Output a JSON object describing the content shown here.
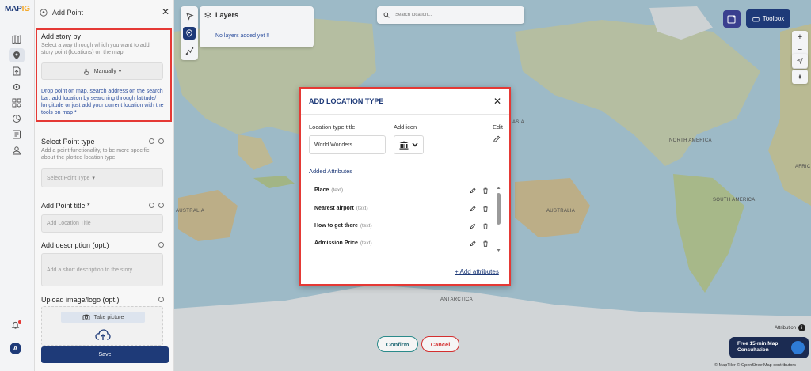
{
  "app": {
    "logo_text_a": "MAP",
    "logo_text_b": "IG"
  },
  "panel": {
    "title": "Add Point",
    "story": {
      "title": "Add story by",
      "hint": "Select a way through which you want to add story point (locations) on the map",
      "mode_label": "Manually",
      "description": "Drop point on map, search address on the search bar, add location by searching through latitude/ longitude or just add your current location with the tools on map *"
    },
    "point_type": {
      "title": "Select Point type",
      "hint": "Add a point functionality, to be more specific about the plotted location type",
      "placeholder": "Select Point Type"
    },
    "point_title": {
      "title": "Add Point title *",
      "placeholder": "Add Location Title"
    },
    "description": {
      "title": "Add description (opt.)",
      "placeholder": "Add a short description to the story"
    },
    "upload": {
      "title": "Upload image/logo (opt.)",
      "take_picture": "Take picture"
    },
    "save_label": "Save"
  },
  "layers": {
    "title": "Layers",
    "empty": "No layers added yet !!"
  },
  "search": {
    "placeholder": "Search location..."
  },
  "toolbox_label": "Toolbox",
  "map_labels": {
    "australia_left": "AUSTRALIA",
    "australia_mid": "AUSTRALIA",
    "north_america": "NORTH AMERICA",
    "south_america": "SOUTH AMERICA",
    "antarctica": "ANTARCTICA",
    "asia": "ASIA",
    "afric": "AFRIC"
  },
  "confirm_label": "Confirm",
  "cancel_label": "Cancel",
  "attribution_label": "Attribution",
  "consult": {
    "line1": "Free 15-min Map",
    "line2": "Consultation"
  },
  "footer_attribution": "© MapTiler © OpenStreetMap contributors",
  "modal": {
    "title": "ADD LOCATION TYPE",
    "type_title_label": "Location type title",
    "type_title_value": "World Wonders",
    "add_icon_label": "Add icon",
    "edit_label": "Edit",
    "added_attributes_label": "Added Attributes",
    "attributes": [
      {
        "name": "Place",
        "type": "(text)"
      },
      {
        "name": "Nearest airport",
        "type": "(text)"
      },
      {
        "name": "How to get there",
        "type": "(text)"
      },
      {
        "name": "Admission Price",
        "type": "(text)"
      }
    ],
    "add_attributes_label": "+ Add attributes"
  },
  "colors": {
    "primary": "#1e3a78",
    "highlight": "#e53935",
    "cancel": "#d32f2f",
    "confirm": "#2a8a8a",
    "link": "#2d4f9e"
  }
}
